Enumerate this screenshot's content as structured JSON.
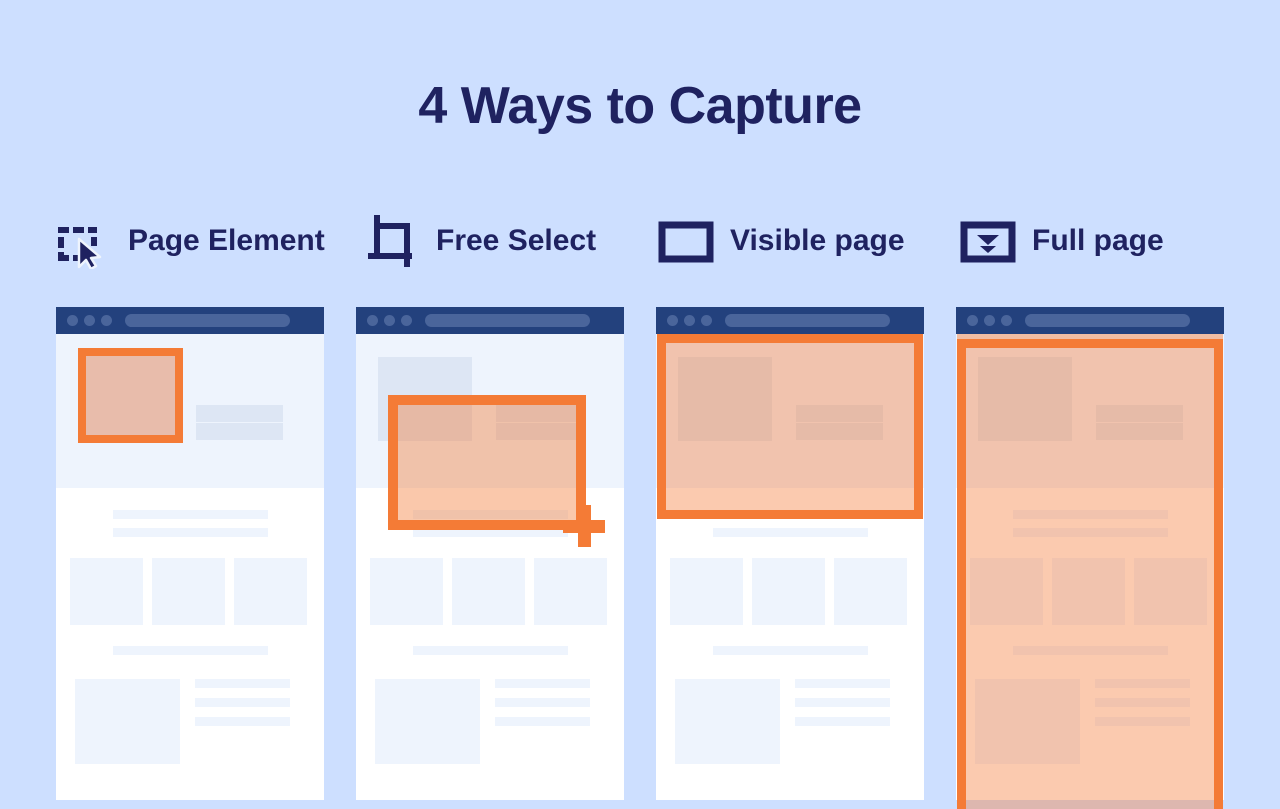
{
  "page": {
    "title": "4 Ways to Capture",
    "background_color": "#cddfff",
    "title_color": "#1f2260",
    "accent_color": "#f47b36",
    "browser_chrome_color": "#23417d"
  },
  "capture_modes": [
    {
      "label": "Page Element",
      "icon": "dashed-square-cursor-icon",
      "selection": "single element highlighted with orange outline"
    },
    {
      "label": "Free Select",
      "icon": "crop-tool-icon",
      "selection": "free-form drag rectangle with crosshair cursor"
    },
    {
      "label": "Visible page",
      "icon": "rectangle-outline-icon",
      "selection": "viewport area highlighted"
    },
    {
      "label": "Full page",
      "icon": "rectangle-double-chevron-down-icon",
      "selection": "entire scrolling page highlighted"
    }
  ],
  "browser_mock": {
    "dots": [
      "dot-1",
      "dot-2",
      "dot-3"
    ],
    "url_bar": "",
    "hero": {
      "image_placeholder": "hero-image",
      "lines": [
        "hero-line-1",
        "hero-line-2"
      ]
    },
    "content": {
      "heading_bars": [
        "content-bar-1",
        "content-bar-2"
      ],
      "columns": [
        "column-card-1",
        "column-card-2",
        "column-card-3"
      ],
      "divider_bar": "content-bar-3",
      "feature": {
        "image_placeholder": "feature-image",
        "lines": [
          "feature-line-1",
          "feature-line-2",
          "feature-line-3"
        ]
      }
    }
  }
}
